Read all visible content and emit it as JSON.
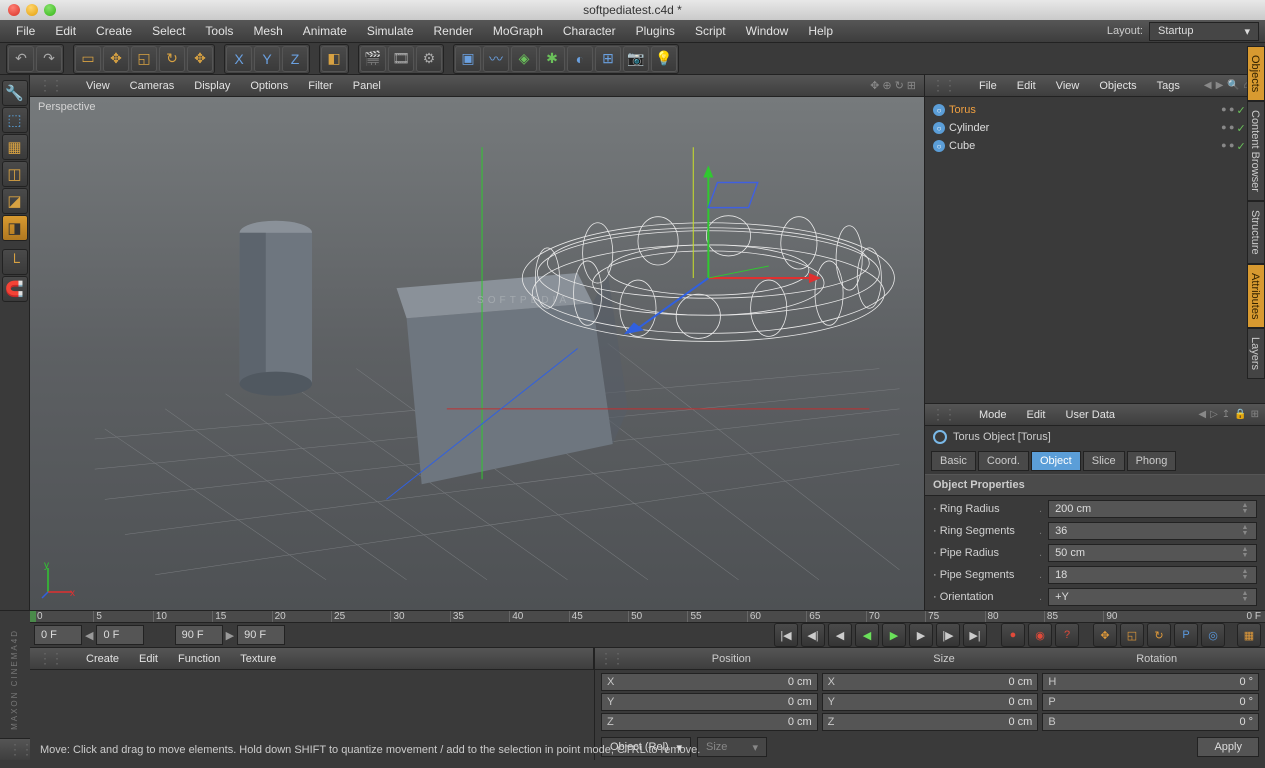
{
  "window_title": "softpediatest.c4d *",
  "menubar": [
    "File",
    "Edit",
    "Create",
    "Select",
    "Tools",
    "Mesh",
    "Animate",
    "Simulate",
    "Render",
    "MoGraph",
    "Character",
    "Plugins",
    "Script",
    "Window",
    "Help"
  ],
  "layout": {
    "label": "Layout:",
    "value": "Startup"
  },
  "viewport_menus": [
    "View",
    "Cameras",
    "Display",
    "Options",
    "Filter",
    "Panel"
  ],
  "viewport_label": "Perspective",
  "watermark": "SOFTPEDIA",
  "obj_panel_menus": [
    "File",
    "Edit",
    "View",
    "Objects",
    "Tags"
  ],
  "objects": [
    {
      "name": "Torus",
      "selected": true
    },
    {
      "name": "Cylinder",
      "selected": false
    },
    {
      "name": "Cube",
      "selected": false
    }
  ],
  "attr_menus": [
    "Mode",
    "Edit",
    "User Data"
  ],
  "attr_title": "Torus Object [Torus]",
  "attr_tabs": [
    "Basic",
    "Coord.",
    "Object",
    "Slice",
    "Phong"
  ],
  "attr_active_tab": 2,
  "prop_head": "Object Properties",
  "props": [
    {
      "label": "Ring Radius",
      "value": "200 cm"
    },
    {
      "label": "Ring Segments",
      "value": "36"
    },
    {
      "label": "Pipe Radius",
      "value": "50 cm"
    },
    {
      "label": "Pipe Segments",
      "value": "18"
    },
    {
      "label": "Orientation",
      "value": "+Y"
    }
  ],
  "side_tabs": [
    "Objects",
    "Content Browser",
    "Structure",
    "Attributes",
    "Layers"
  ],
  "side_active": [
    0,
    3
  ],
  "timeline": {
    "start": 0,
    "end": 90,
    "ticks": [
      0,
      5,
      10,
      15,
      20,
      25,
      30,
      35,
      40,
      45,
      50,
      55,
      60,
      65,
      70,
      75,
      80,
      85,
      90
    ],
    "current_label": "0 F"
  },
  "tl_inputs": [
    "0 F",
    "0 F",
    "90 F",
    "90 F"
  ],
  "mat_menus": [
    "Create",
    "Edit",
    "Function",
    "Texture"
  ],
  "coord_headers": [
    "Position",
    "Size",
    "Rotation"
  ],
  "coords": [
    {
      "a": "X",
      "av": "0 cm",
      "b": "X",
      "bv": "0 cm",
      "c": "H",
      "cv": "0 °"
    },
    {
      "a": "Y",
      "av": "0 cm",
      "b": "Y",
      "bv": "0 cm",
      "c": "P",
      "cv": "0 °"
    },
    {
      "a": "Z",
      "av": "0 cm",
      "b": "Z",
      "bv": "0 cm",
      "c": "B",
      "cv": "0 °"
    }
  ],
  "coord_footer": {
    "obj": "Object (Rel)",
    "size": "Size",
    "apply": "Apply"
  },
  "status": "Move: Click and drag to move elements. Hold down SHIFT to quantize movement / add to the selection in point mode, CTRL to remove.",
  "brand": "MAXON\nCINEMA4D"
}
